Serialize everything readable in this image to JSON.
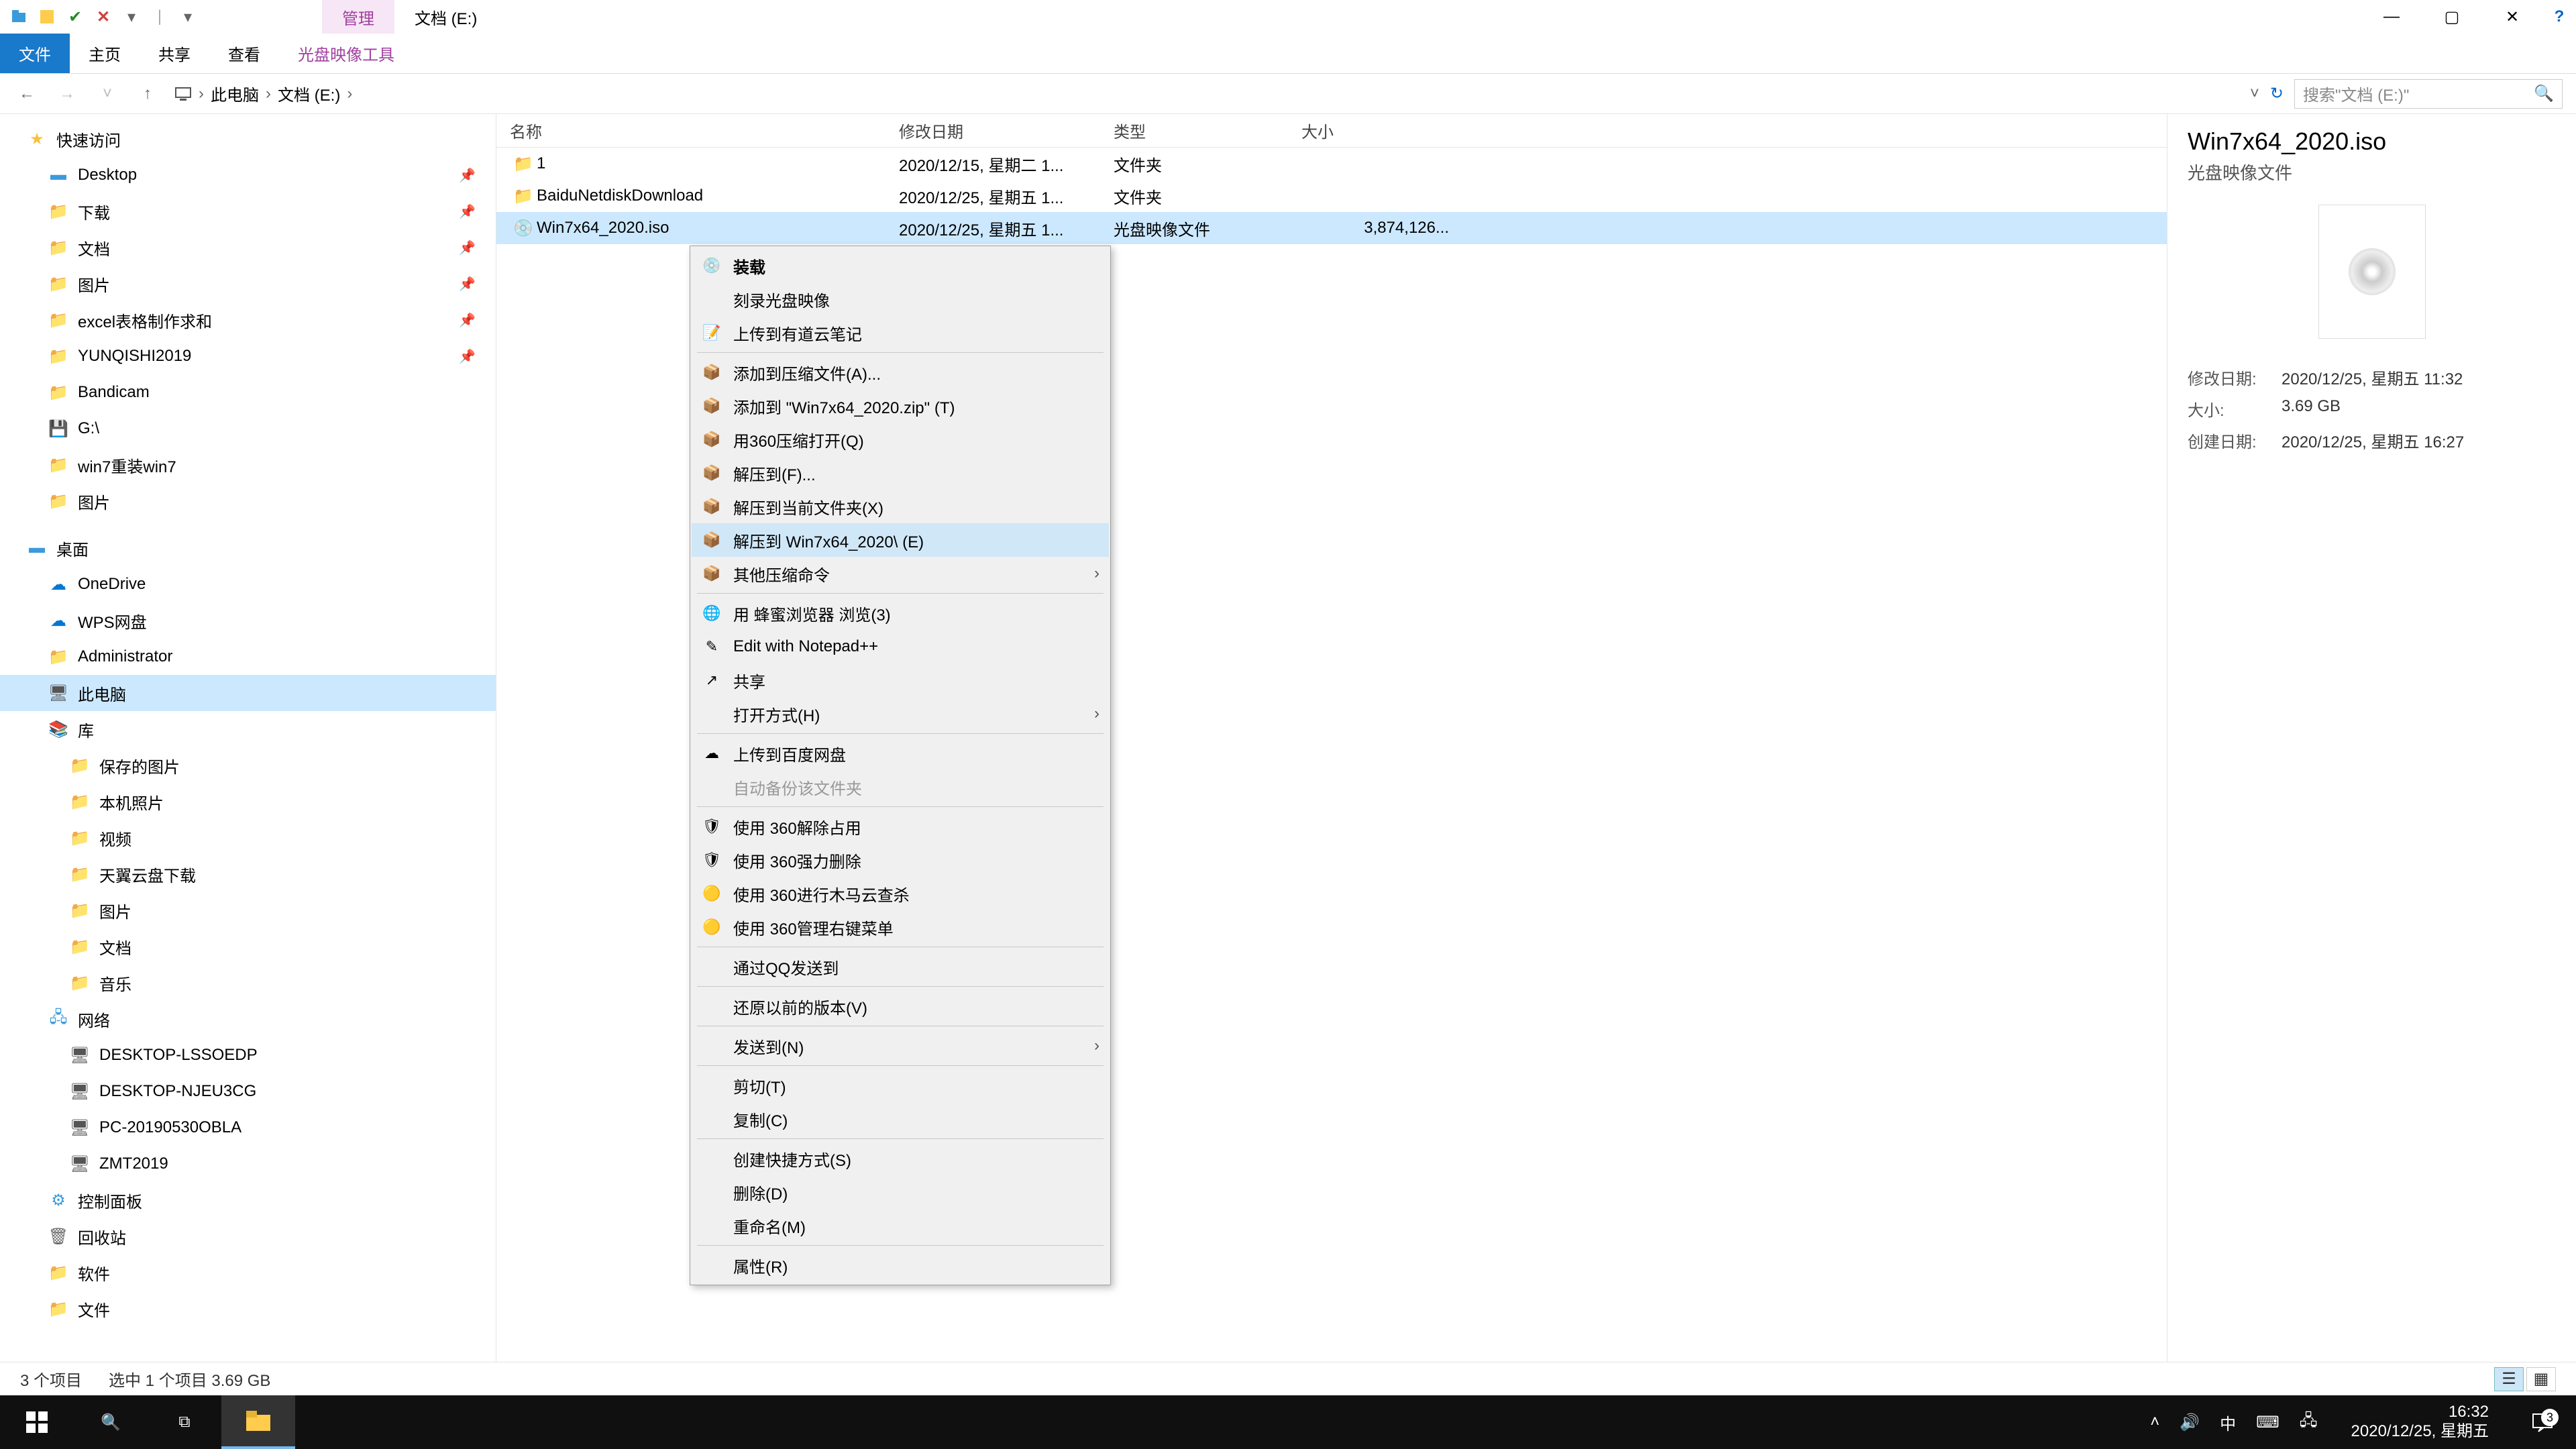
{
  "titlebar": {
    "manage_tab": "管理",
    "window_title": "文档 (E:)"
  },
  "ribbon": {
    "file": "文件",
    "home": "主页",
    "share": "共享",
    "view": "查看",
    "disc_tools": "光盘映像工具"
  },
  "address": {
    "back": "←",
    "forward": "→",
    "up": "↑",
    "crumbs": [
      "此电脑",
      "文档 (E:)"
    ],
    "search_placeholder": "搜索\"文档 (E:)\""
  },
  "sidebar": {
    "quick_access": "快速访问",
    "items_qa": [
      {
        "label": "Desktop",
        "pinned": true,
        "icon": "desktop"
      },
      {
        "label": "下载",
        "pinned": true,
        "icon": "folder"
      },
      {
        "label": "文档",
        "pinned": true,
        "icon": "folder"
      },
      {
        "label": "图片",
        "pinned": true,
        "icon": "folder"
      },
      {
        "label": "excel表格制作求和",
        "pinned": true,
        "icon": "folder"
      },
      {
        "label": "YUNQISHI2019",
        "pinned": true,
        "icon": "folder"
      },
      {
        "label": "Bandicam",
        "pinned": false,
        "icon": "folder"
      },
      {
        "label": "G:\\",
        "pinned": false,
        "icon": "drive"
      },
      {
        "label": "win7重装win7",
        "pinned": false,
        "icon": "folder"
      },
      {
        "label": "图片",
        "pinned": false,
        "icon": "folder"
      }
    ],
    "desktop": "桌面",
    "items_desktop": [
      {
        "label": "OneDrive",
        "icon": "cloud"
      },
      {
        "label": "WPS网盘",
        "icon": "cloud"
      },
      {
        "label": "Administrator",
        "icon": "folder"
      },
      {
        "label": "此电脑",
        "icon": "pc",
        "selected": true
      },
      {
        "label": "库",
        "icon": "lib"
      }
    ],
    "items_lib": [
      {
        "label": "保存的图片",
        "icon": "folder"
      },
      {
        "label": "本机照片",
        "icon": "folder"
      },
      {
        "label": "视频",
        "icon": "folder"
      },
      {
        "label": "天翼云盘下载",
        "icon": "folder"
      },
      {
        "label": "图片",
        "icon": "folder"
      },
      {
        "label": "文档",
        "icon": "folder"
      },
      {
        "label": "音乐",
        "icon": "folder"
      }
    ],
    "network": "网络",
    "items_net": [
      {
        "label": "DESKTOP-LSSOEDP",
        "icon": "pc"
      },
      {
        "label": "DESKTOP-NJEU3CG",
        "icon": "pc"
      },
      {
        "label": "PC-20190530OBLA",
        "icon": "pc"
      },
      {
        "label": "ZMT2019",
        "icon": "pc"
      }
    ],
    "control_panel": "控制面板",
    "recycle_bin": "回收站",
    "software": "软件",
    "documents": "文件"
  },
  "columns": {
    "name": "名称",
    "date": "修改日期",
    "type": "类型",
    "size": "大小"
  },
  "files": [
    {
      "name": "1",
      "date": "2020/12/15, 星期二 1...",
      "type": "文件夹",
      "size": "",
      "icon": "folder"
    },
    {
      "name": "BaiduNetdiskDownload",
      "date": "2020/12/25, 星期五 1...",
      "type": "文件夹",
      "size": "",
      "icon": "folder"
    },
    {
      "name": "Win7x64_2020.iso",
      "date": "2020/12/25, 星期五 1...",
      "type": "光盘映像文件",
      "size": "3,874,126...",
      "icon": "disc",
      "selected": true
    }
  ],
  "details": {
    "title": "Win7x64_2020.iso",
    "subtitle": "光盘映像文件",
    "modified_label": "修改日期:",
    "modified_value": "2020/12/25, 星期五 11:32",
    "size_label": "大小:",
    "size_value": "3.69 GB",
    "created_label": "创建日期:",
    "created_value": "2020/12/25, 星期五 16:27"
  },
  "context_menu": [
    {
      "type": "item",
      "label": "装载",
      "bold": true,
      "icon": "disc"
    },
    {
      "type": "item",
      "label": "刻录光盘映像"
    },
    {
      "type": "item",
      "label": "上传到有道云笔记",
      "icon": "note"
    },
    {
      "type": "sep"
    },
    {
      "type": "item",
      "label": "添加到压缩文件(A)...",
      "icon": "archive"
    },
    {
      "type": "item",
      "label": "添加到 \"Win7x64_2020.zip\" (T)",
      "icon": "archive"
    },
    {
      "type": "item",
      "label": "用360压缩打开(Q)",
      "icon": "archive"
    },
    {
      "type": "item",
      "label": "解压到(F)...",
      "icon": "archive"
    },
    {
      "type": "item",
      "label": "解压到当前文件夹(X)",
      "icon": "archive"
    },
    {
      "type": "item",
      "label": "解压到 Win7x64_2020\\ (E)",
      "icon": "archive",
      "hover": true
    },
    {
      "type": "item",
      "label": "其他压缩命令",
      "icon": "archive",
      "arrow": true
    },
    {
      "type": "sep"
    },
    {
      "type": "item",
      "label": "用 蜂蜜浏览器 浏览(3)",
      "icon": "browser"
    },
    {
      "type": "item",
      "label": "Edit with Notepad++",
      "icon": "edit"
    },
    {
      "type": "item",
      "label": "共享",
      "icon": "share"
    },
    {
      "type": "item",
      "label": "打开方式(H)",
      "arrow": true
    },
    {
      "type": "sep"
    },
    {
      "type": "item",
      "label": "上传到百度网盘",
      "icon": "cloud"
    },
    {
      "type": "item",
      "label": "自动备份该文件夹",
      "disabled": true
    },
    {
      "type": "sep"
    },
    {
      "type": "item",
      "label": "使用 360解除占用",
      "icon": "360"
    },
    {
      "type": "item",
      "label": "使用 360强力删除",
      "icon": "360"
    },
    {
      "type": "item",
      "label": "使用 360进行木马云查杀",
      "icon": "360y"
    },
    {
      "type": "item",
      "label": "使用 360管理右键菜单",
      "icon": "360y"
    },
    {
      "type": "sep"
    },
    {
      "type": "item",
      "label": "通过QQ发送到"
    },
    {
      "type": "sep"
    },
    {
      "type": "item",
      "label": "还原以前的版本(V)"
    },
    {
      "type": "sep"
    },
    {
      "type": "item",
      "label": "发送到(N)",
      "arrow": true
    },
    {
      "type": "sep"
    },
    {
      "type": "item",
      "label": "剪切(T)"
    },
    {
      "type": "item",
      "label": "复制(C)"
    },
    {
      "type": "sep"
    },
    {
      "type": "item",
      "label": "创建快捷方式(S)"
    },
    {
      "type": "item",
      "label": "删除(D)"
    },
    {
      "type": "item",
      "label": "重命名(M)"
    },
    {
      "type": "sep"
    },
    {
      "type": "item",
      "label": "属性(R)"
    }
  ],
  "statusbar": {
    "items": "3 个项目",
    "selection": "选中 1 个项目  3.69 GB"
  },
  "taskbar": {
    "time": "16:32",
    "date": "2020/12/25, 星期五",
    "ime": "中",
    "notif_count": "3"
  }
}
